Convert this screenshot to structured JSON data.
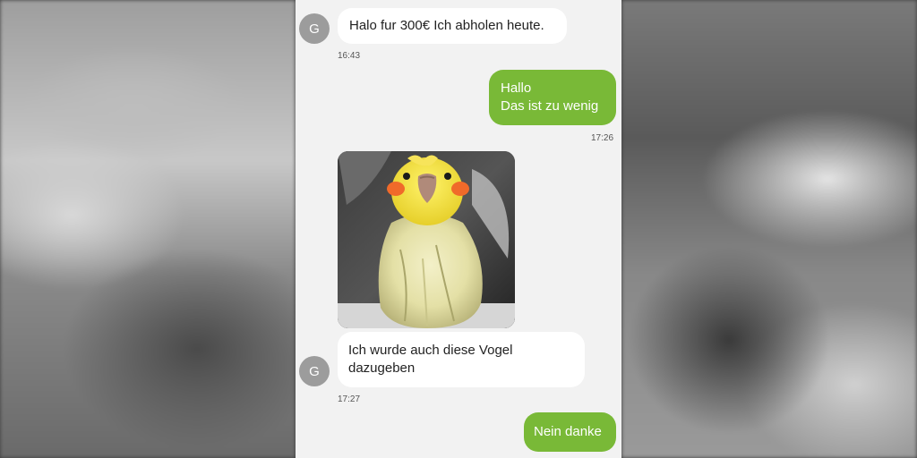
{
  "chat": {
    "messages": [
      {
        "sender_initial": "G",
        "text": "Halo fur 300€ Ich abholen heute.",
        "time": "16:43"
      },
      {
        "line1": "Hallo",
        "line2": "Das ist zu wenig",
        "time": "17:26"
      },
      {
        "photo_subject": "bird"
      },
      {
        "sender_initial": "G",
        "line1": "Ich wurde auch diese Vogel",
        "line2": "dazugeben",
        "time": "17:27"
      },
      {
        "text": "Nein danke"
      }
    ]
  },
  "colors": {
    "incoming_bubble": "#ffffff",
    "outgoing_bubble": "#79b937",
    "chat_background": "#f2f2f2",
    "avatar": "#9c9c9c"
  }
}
